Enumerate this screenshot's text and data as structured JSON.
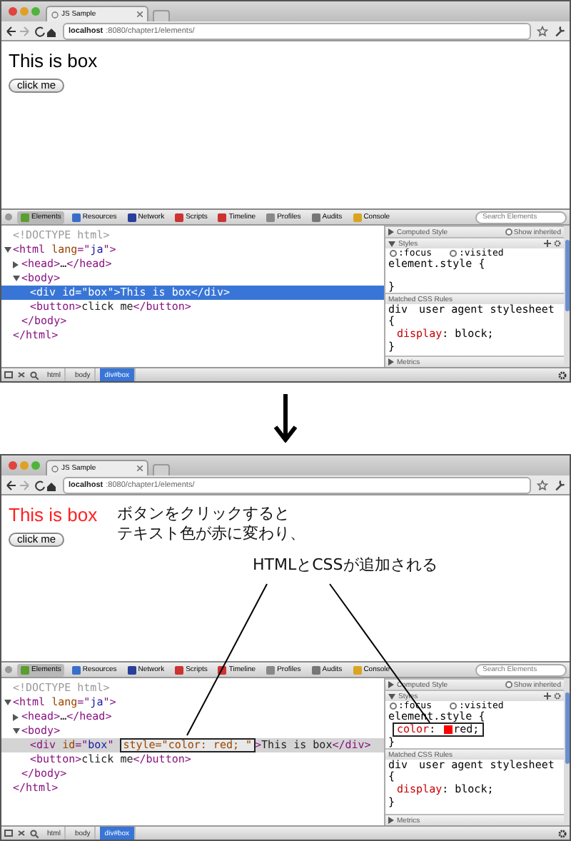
{
  "windows": [
    {
      "tab_title": "JS Sample",
      "url_host": "localhost",
      "url_path": ":8080/chapter1/elements/",
      "page": {
        "box_text": "This is box",
        "box_changed": false,
        "button": "click me",
        "callout": false
      },
      "devtools": {
        "tabs": [
          {
            "label": "Elements",
            "selected": true
          },
          {
            "label": "Resources",
            "selected": false
          },
          {
            "label": "Network",
            "selected": false
          },
          {
            "label": "Scripts",
            "selected": false
          },
          {
            "label": "Timeline",
            "selected": false
          },
          {
            "label": "Profiles",
            "selected": false
          },
          {
            "label": "Audits",
            "selected": false
          },
          {
            "label": "Console",
            "selected": false
          }
        ],
        "search_placeholder": "Search Elements",
        "selection_focused": true,
        "dom": [
          {
            "selected": false,
            "tokens": [
              {
                "kind": "doctype",
                "text": "<!DOCTYPE html>"
              }
            ]
          },
          {
            "selected": false,
            "expanded": true,
            "tokens": [
              {
                "kind": "tag",
                "text": "<html "
              },
              {
                "kind": "attr",
                "text": "lang"
              },
              {
                "kind": "tag",
                "text": "=\""
              },
              {
                "kind": "value",
                "text": "ja"
              },
              {
                "kind": "tag",
                "text": "\">"
              }
            ],
            "closing": [
              {
                "kind": "tag",
                "text": "</html>"
              }
            ],
            "children": [
              {
                "selected": false,
                "expanded": false,
                "tokens": [
                  {
                    "kind": "tag",
                    "text": "<head>"
                  },
                  {
                    "kind": "text",
                    "text": "…"
                  },
                  {
                    "kind": "tag",
                    "text": "</head>"
                  }
                ]
              },
              {
                "selected": false,
                "expanded": true,
                "tokens": [
                  {
                    "kind": "tag",
                    "text": "<body>"
                  }
                ],
                "closing": [
                  {
                    "kind": "tag",
                    "text": "</body>"
                  }
                ],
                "children": [
                  {
                    "selected": true,
                    "tokens": [
                      {
                        "kind": "tag",
                        "text": "<div "
                      },
                      {
                        "kind": "attr",
                        "text": "id"
                      },
                      {
                        "kind": "tag",
                        "text": "=\""
                      },
                      {
                        "kind": "value",
                        "text": "box"
                      },
                      {
                        "kind": "tag",
                        "text": "\">"
                      },
                      {
                        "kind": "text",
                        "text": "This is box"
                      },
                      {
                        "kind": "tag",
                        "text": "</div>"
                      }
                    ]
                  },
                  {
                    "selected": false,
                    "tokens": [
                      {
                        "kind": "tag",
                        "text": "<button>"
                      },
                      {
                        "kind": "text",
                        "text": "click me"
                      },
                      {
                        "kind": "tag",
                        "text": "</button>"
                      }
                    ]
                  }
                ]
              }
            ]
          }
        ],
        "styles": {
          "computed_header": "Computed Style",
          "show_inherited": "Show inherited",
          "show_inherited_checked": false,
          "styles_header": "Styles",
          "pseudo": [
            {
              "label": ":focus",
              "checked": false
            },
            {
              "label": ":visited",
              "checked": false
            }
          ],
          "element_open": "element.style {",
          "element_close": "}",
          "matched_header": "Matched CSS Rules",
          "matched": [
            {
              "selector": "div",
              "source": "user agent stylesheet",
              "open": "{",
              "props": [
                {
                  "name": "display",
                  "sep": ": ",
                  "value": "block;",
                  "highlighted": false
                }
              ],
              "close": "}"
            }
          ],
          "metrics_header": "Metrics"
        },
        "breadcrumbs": [
          {
            "label": "html",
            "selected": false
          },
          {
            "label": "body",
            "selected": false
          },
          {
            "label": "div#box",
            "selected": true
          }
        ]
      }
    },
    {
      "tab_title": "JS Sample",
      "url_host": "localhost",
      "url_path": ":8080/chapter1/elements/",
      "page": {
        "box_text": "This is box",
        "box_changed": true,
        "button": "click me",
        "note_lines": [
          "ボタンをクリックすると",
          "テキスト色が赤に変わり、"
        ],
        "caption": "HTMLとCSSが追加される",
        "callout": true
      },
      "devtools": {
        "tabs": [
          {
            "label": "Elements",
            "selected": true
          },
          {
            "label": "Resources",
            "selected": false
          },
          {
            "label": "Network",
            "selected": false
          },
          {
            "label": "Scripts",
            "selected": false
          },
          {
            "label": "Timeline",
            "selected": false
          },
          {
            "label": "Profiles",
            "selected": false
          },
          {
            "label": "Audits",
            "selected": false
          },
          {
            "label": "Console",
            "selected": false
          }
        ],
        "search_placeholder": "Search Elements",
        "selection_focused": false,
        "dom": [
          {
            "selected": false,
            "tokens": [
              {
                "kind": "doctype",
                "text": "<!DOCTYPE html>"
              }
            ]
          },
          {
            "selected": false,
            "expanded": true,
            "tokens": [
              {
                "kind": "tag",
                "text": "<html "
              },
              {
                "kind": "attr",
                "text": "lang"
              },
              {
                "kind": "tag",
                "text": "=\""
              },
              {
                "kind": "value",
                "text": "ja"
              },
              {
                "kind": "tag",
                "text": "\">"
              }
            ],
            "closing": [
              {
                "kind": "tag",
                "text": "</html>"
              }
            ],
            "children": [
              {
                "selected": false,
                "expanded": false,
                "tokens": [
                  {
                    "kind": "tag",
                    "text": "<head>"
                  },
                  {
                    "kind": "text",
                    "text": "…"
                  },
                  {
                    "kind": "tag",
                    "text": "</head>"
                  }
                ]
              },
              {
                "selected": false,
                "expanded": true,
                "tokens": [
                  {
                    "kind": "tag",
                    "text": "<body>"
                  }
                ],
                "closing": [
                  {
                    "kind": "tag",
                    "text": "</body>"
                  }
                ],
                "children": [
                  {
                    "selected": true,
                    "tokens": [
                      {
                        "kind": "tag",
                        "text": "<div "
                      },
                      {
                        "kind": "attr",
                        "text": "id"
                      },
                      {
                        "kind": "tag",
                        "text": "=\""
                      },
                      {
                        "kind": "value",
                        "text": "box"
                      },
                      {
                        "kind": "tag",
                        "text": "\" "
                      },
                      {
                        "kind": "added",
                        "text": "style=\"color: red; \""
                      },
                      {
                        "kind": "tag",
                        "text": ">"
                      },
                      {
                        "kind": "text",
                        "text": "This is box"
                      },
                      {
                        "kind": "tag",
                        "text": "</div>"
                      }
                    ]
                  },
                  {
                    "selected": false,
                    "tokens": [
                      {
                        "kind": "tag",
                        "text": "<button>"
                      },
                      {
                        "kind": "text",
                        "text": "click me"
                      },
                      {
                        "kind": "tag",
                        "text": "</button>"
                      }
                    ]
                  }
                ]
              }
            ]
          }
        ],
        "styles": {
          "computed_header": "Computed Style",
          "show_inherited": "Show inherited",
          "show_inherited_checked": false,
          "styles_header": "Styles",
          "pseudo": [
            {
              "label": ":focus",
              "checked": false
            },
            {
              "label": ":visited",
              "checked": false
            }
          ],
          "element_open": "element.style {",
          "element_props": [
            {
              "name": "color",
              "sep": ": ",
              "swatch": true,
              "value": "red;",
              "highlighted": true
            }
          ],
          "element_close": "}",
          "matched_header": "Matched CSS Rules",
          "matched": [
            {
              "selector": "div",
              "source": "user agent stylesheet",
              "open": "{",
              "props": [
                {
                  "name": "display",
                  "sep": ": ",
                  "value": "block;",
                  "highlighted": false
                }
              ],
              "close": "}"
            }
          ],
          "metrics_header": "Metrics"
        },
        "breadcrumbs": [
          {
            "label": "html",
            "selected": false
          },
          {
            "label": "body",
            "selected": false
          },
          {
            "label": "div#box",
            "selected": true
          }
        ]
      }
    }
  ]
}
